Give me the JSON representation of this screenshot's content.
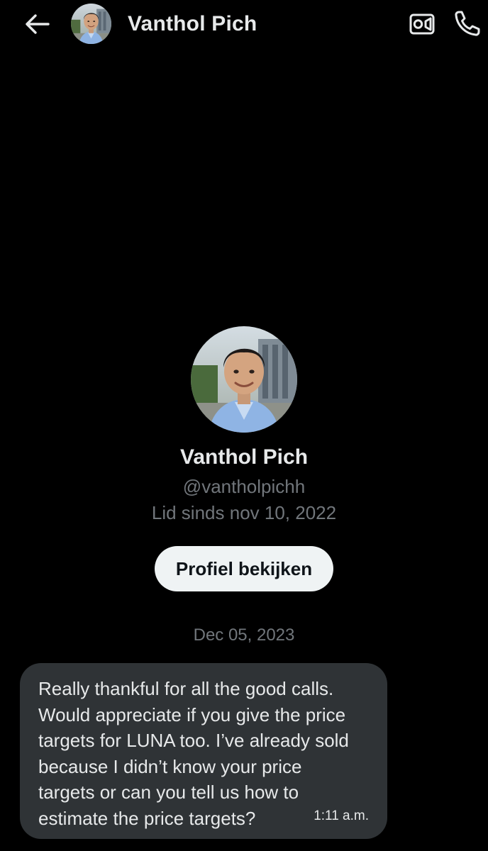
{
  "header": {
    "contact_name": "Vanthol Pich",
    "back_icon": "arrow-left-icon",
    "video_icon": "video-camera-icon",
    "phone_icon": "phone-icon"
  },
  "profile": {
    "name": "Vanthol Pich",
    "handle": "@vantholpichh",
    "joined": "Lid sinds nov 10, 2022",
    "view_profile_label": "Profiel bekijken"
  },
  "conversation": {
    "date_divider": "Dec 05, 2023",
    "messages": [
      {
        "text": "Really thankful for all the good calls.\nWould appreciate if you give the price\ntargets for LUNA too. I’ve already sold\nbecause I didn’t know your price\ntargets or can you tell us how to\nestimate the price targets?",
        "time": "1:11 a.m."
      }
    ]
  },
  "colors": {
    "background": "#000000",
    "primary_text": "#e7e9ea",
    "secondary_text": "#71767b",
    "bubble": "#2f3336",
    "button_bg": "#eff3f4"
  }
}
